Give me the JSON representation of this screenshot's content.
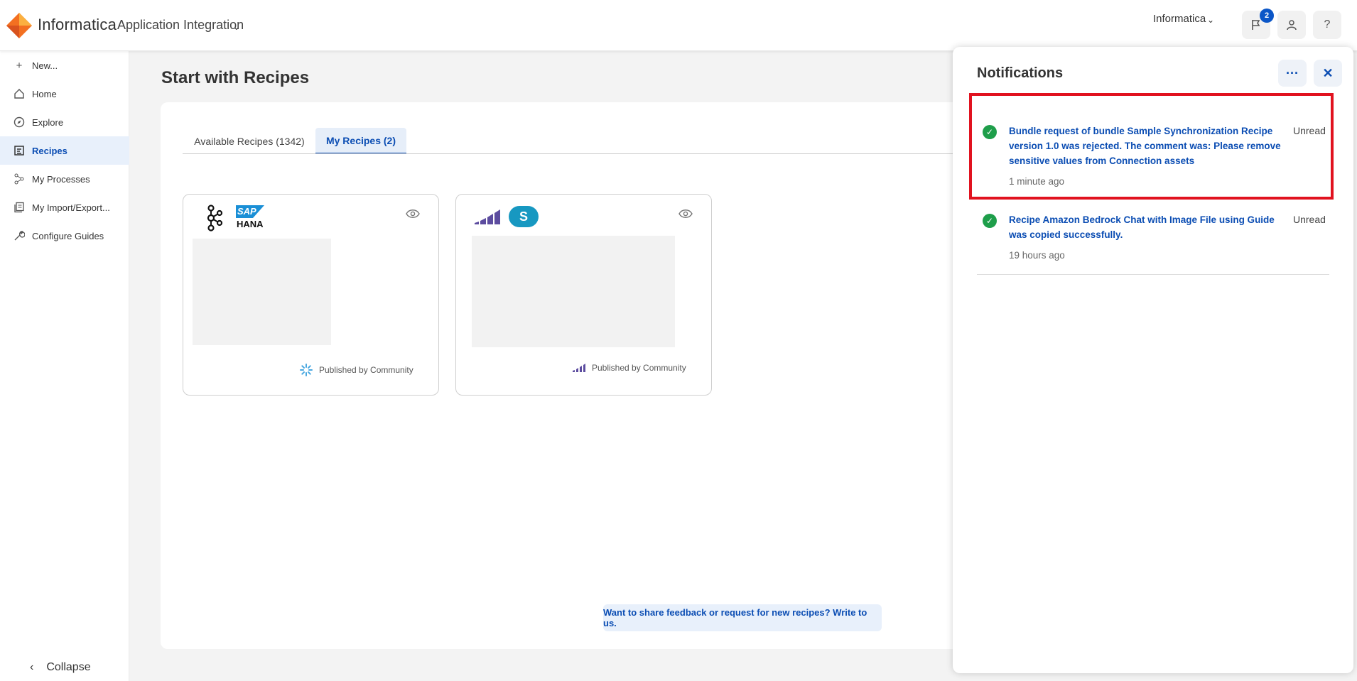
{
  "header": {
    "brand": "Informatica",
    "product": "Application Integration",
    "org": "Informatica",
    "notification_count": "2",
    "brand_color": "#f37021"
  },
  "sidebar": {
    "items": [
      {
        "label": "New...",
        "icon": "plus-icon"
      },
      {
        "label": "Home",
        "icon": "home-icon"
      },
      {
        "label": "Explore",
        "icon": "compass-icon"
      },
      {
        "label": "Recipes",
        "icon": "recipes-icon",
        "active": true
      },
      {
        "label": "My Processes",
        "icon": "processes-icon"
      },
      {
        "label": "My Import/Export...",
        "icon": "import-export-icon"
      },
      {
        "label": "Configure Guides",
        "icon": "wrench-icon"
      }
    ],
    "collapse_label": "Collapse"
  },
  "main": {
    "title": "Start with Recipes",
    "tabs": [
      {
        "label": "Available Recipes (1342)"
      },
      {
        "label": "My Recipes (2)",
        "active": true
      }
    ],
    "cards": [
      {
        "logos": [
          "kafka-logo",
          "sap-hana-logo"
        ],
        "sap_text": "SAP",
        "hana_text": "HANA",
        "publisher": "Published by Community"
      },
      {
        "logos": [
          "marketo-logo",
          "salesforce-logo"
        ],
        "sf_text": "S",
        "publisher": "Published by Community"
      }
    ],
    "feedback": "Want to share feedback or request for new recipes? Write to us."
  },
  "notifications": {
    "title": "Notifications",
    "items": [
      {
        "message": "Bundle request of bundle Sample Synchronization Recipe version 1.0 was rejected. The comment was: Please remove sensitive values from Connection assets",
        "status": "Unread",
        "time": "1 minute ago"
      },
      {
        "message": "Recipe Amazon Bedrock Chat with Image File using Guide was copied successfully.",
        "status": "Unread",
        "time": "19 hours ago"
      }
    ]
  }
}
